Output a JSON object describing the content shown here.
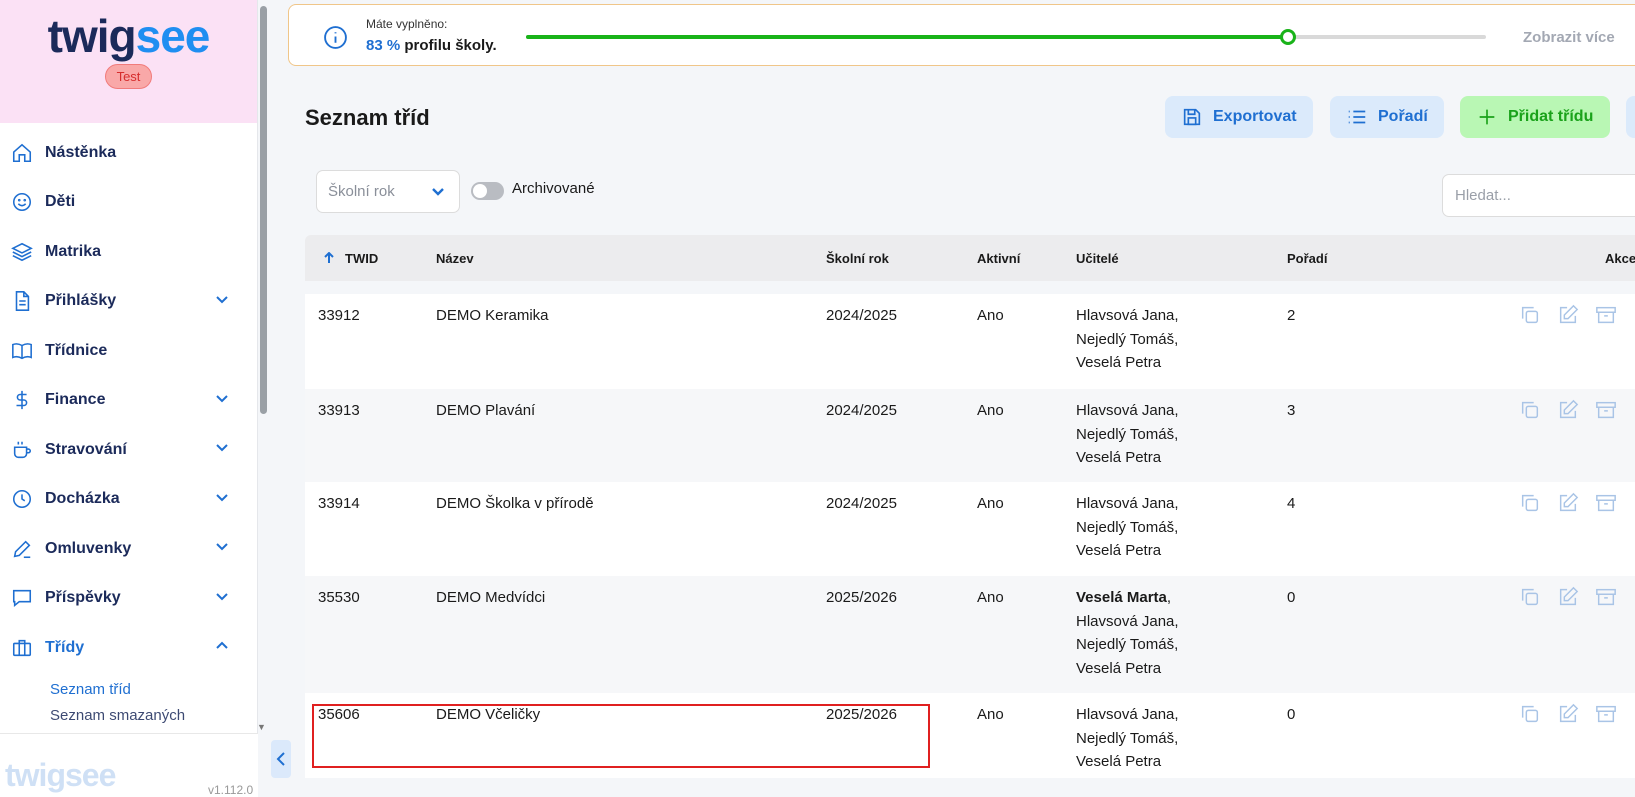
{
  "sidebar": {
    "logo_part1": "twig",
    "logo_part2": "see",
    "badge": "Test",
    "items": [
      {
        "label": "Nástěnka",
        "icon": "home-icon",
        "has_chevron": false
      },
      {
        "label": "Děti",
        "icon": "smile-icon",
        "has_chevron": false
      },
      {
        "label": "Matrika",
        "icon": "layers-icon",
        "has_chevron": false
      },
      {
        "label": "Přihlášky",
        "icon": "document-icon",
        "has_chevron": true
      },
      {
        "label": "Třídnice",
        "icon": "book-icon",
        "has_chevron": false
      },
      {
        "label": "Finance",
        "icon": "dollar-icon",
        "has_chevron": true
      },
      {
        "label": "Stravování",
        "icon": "cup-icon",
        "has_chevron": true
      },
      {
        "label": "Docházka",
        "icon": "clock-icon",
        "has_chevron": true
      },
      {
        "label": "Omluvenky",
        "icon": "pen-icon",
        "has_chevron": true
      },
      {
        "label": "Příspěvky",
        "icon": "chat-icon",
        "has_chevron": true
      },
      {
        "label": "Třídy",
        "icon": "briefcase-icon",
        "has_chevron": true,
        "expanded": true
      }
    ],
    "subitems": [
      "Seznam tříd",
      "Seznam smazaných"
    ],
    "bottom_logo": "twigsee",
    "version": "v1.112.0"
  },
  "banner": {
    "label": "Máte vyplněno:",
    "percent_text": "83 %",
    "suffix": "profilu školy.",
    "progress": 0.794,
    "more": "Zobrazit více"
  },
  "header": {
    "title": "Seznam tříd",
    "export": "Exportovat",
    "order": "Pořadí",
    "add": "Přidat třídu"
  },
  "filters": {
    "school_year_placeholder": "Školní rok",
    "archived_label": "Archivované",
    "search_placeholder": "Hledat..."
  },
  "table": {
    "columns": {
      "twid": "TWID",
      "name": "Název",
      "year": "Školní rok",
      "active": "Aktivní",
      "teachers": "Učitelé",
      "order": "Pořadí",
      "actions": "Akce"
    },
    "rows": [
      {
        "twid": "33912",
        "name": "DEMO Keramika",
        "year": "2024/2025",
        "active": "Ano",
        "teachers": [
          "Hlavsová Jana,",
          "Nejedlý Tomáš,",
          "Veselá Petra"
        ],
        "order": "2"
      },
      {
        "twid": "33913",
        "name": "DEMO Plavání",
        "year": "2024/2025",
        "active": "Ano",
        "teachers": [
          "Hlavsová Jana,",
          "Nejedlý Tomáš,",
          "Veselá Petra"
        ],
        "order": "3"
      },
      {
        "twid": "33914",
        "name": "DEMO Školka v přírodě",
        "year": "2024/2025",
        "active": "Ano",
        "teachers": [
          "Hlavsová Jana,",
          "Nejedlý Tomáš,",
          "Veselá Petra"
        ],
        "order": "4"
      },
      {
        "twid": "35530",
        "name": "DEMO Medvídci",
        "year": "2025/2026",
        "active": "Ano",
        "teachers_lead": "Veselá Marta",
        "teachers": [
          "Hlavsová Jana,",
          "Nejedlý Tomáš,",
          "Veselá Petra"
        ],
        "order": "0"
      },
      {
        "twid": "35606",
        "name": "DEMO Včeličky",
        "year": "2025/2026",
        "active": "Ano",
        "teachers": [
          "Hlavsová Jana,",
          "Nejedlý Tomáš,",
          "Veselá Petra"
        ],
        "order": "0"
      }
    ]
  },
  "colors": {
    "accent": "#1f6fd1",
    "progress": "#19b319",
    "add_button_bg": "#b9f7b4",
    "highlight": "#e02020"
  }
}
